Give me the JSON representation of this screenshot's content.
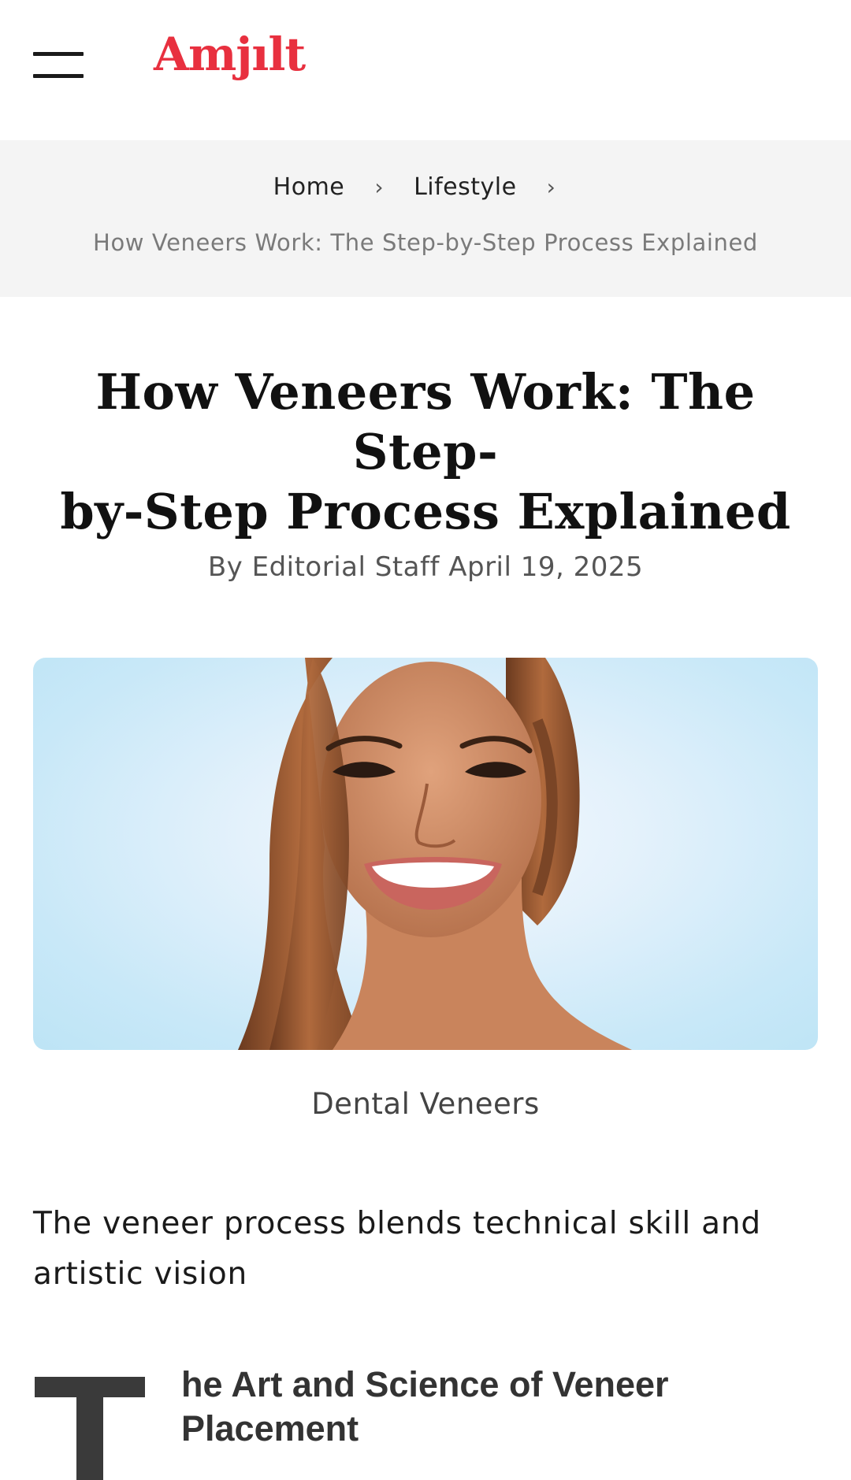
{
  "header": {
    "logo_text": "Amjılt",
    "logo_color": "#e8303f",
    "menu_icon": "hamburger-menu-icon"
  },
  "breadcrumb": {
    "items": [
      "Home",
      "Lifestyle"
    ],
    "separator_icon": "chevron-right-icon",
    "current": "How Veneers Work: The Step-by-Step Process Explained"
  },
  "article": {
    "title_line1": "How Veneers Work: The Step-",
    "title_line2": "by-Step Process Explained",
    "byline": "By Editorial Staff April 19, 2025",
    "hero_image_alt": "Dental Veneers",
    "caption": "Dental Veneers",
    "intro": "The veneer process blends technical skill and artistic vision",
    "dropcap_letter": "T",
    "section_heading": "he Art and Science of Veneer Placement"
  }
}
